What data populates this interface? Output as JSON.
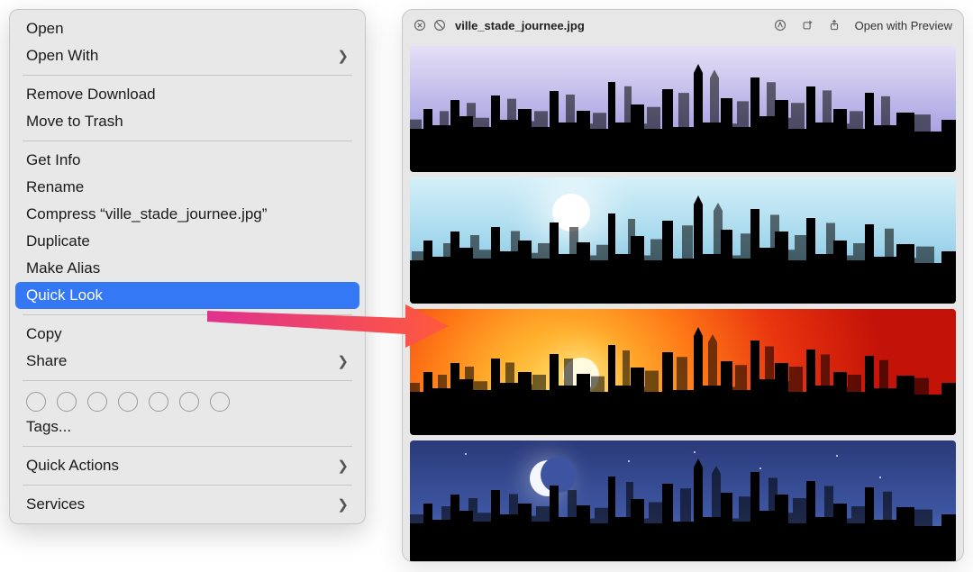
{
  "context_menu": {
    "items": [
      {
        "label": "Open",
        "arrow": false,
        "highlight": false
      },
      {
        "label": "Open With",
        "arrow": true,
        "highlight": false
      }
    ],
    "items2": [
      {
        "label": "Remove Download",
        "arrow": false
      },
      {
        "label": "Move to Trash",
        "arrow": false
      }
    ],
    "items3": [
      {
        "label": "Get Info",
        "arrow": false
      },
      {
        "label": "Rename",
        "arrow": false
      },
      {
        "label": "Compress “ville_stade_journee.jpg”",
        "arrow": false
      },
      {
        "label": "Duplicate",
        "arrow": false
      },
      {
        "label": "Make Alias",
        "arrow": false
      },
      {
        "label": "Quick Look",
        "arrow": false,
        "highlight": true
      }
    ],
    "items4": [
      {
        "label": "Copy",
        "arrow": false
      },
      {
        "label": "Share",
        "arrow": true
      }
    ],
    "tags_label": "Tags...",
    "items5": [
      {
        "label": "Quick Actions",
        "arrow": true
      }
    ],
    "items6": [
      {
        "label": "Services",
        "arrow": true
      }
    ],
    "tag_circle_count": 7
  },
  "preview": {
    "filename": "ville_stade_journee.jpg",
    "open_with_preview": "Open with Preview"
  }
}
